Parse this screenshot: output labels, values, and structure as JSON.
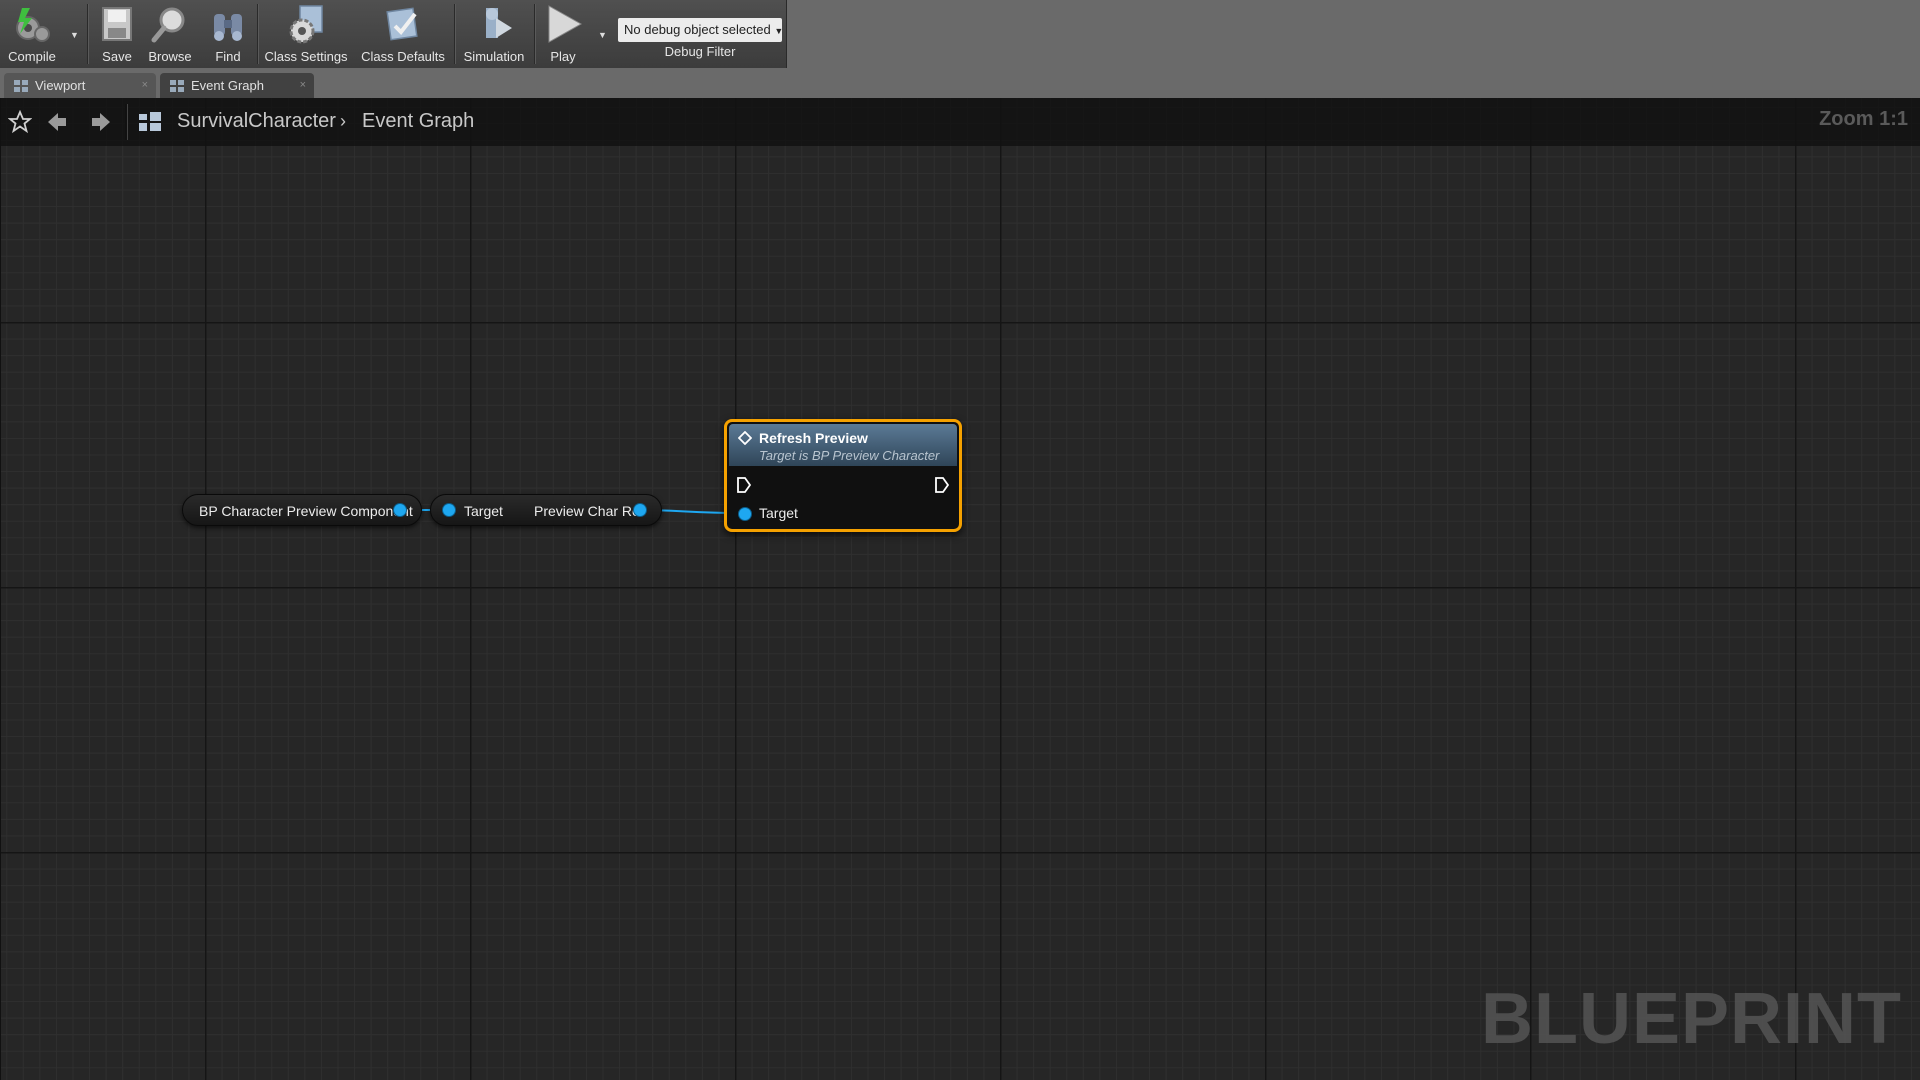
{
  "toolbar": {
    "compile": "Compile",
    "save": "Save",
    "browse": "Browse",
    "find": "Find",
    "class_settings": "Class Settings",
    "class_defaults": "Class Defaults",
    "simulation": "Simulation",
    "play": "Play",
    "debug_object": "No debug object selected",
    "debug_filter": "Debug Filter"
  },
  "tabs": [
    {
      "label": "Viewport",
      "active": false
    },
    {
      "label": "Event Graph",
      "active": true
    }
  ],
  "breadcrumb": {
    "root": "SurvivalCharacter",
    "current": "Event Graph"
  },
  "zoom": "Zoom 1:1",
  "watermark": "BLUEPRINT",
  "graph": {
    "component_node": "BP Character Preview Component",
    "getter_target": "Target",
    "getter_output": "Preview Char Ref",
    "function_node": {
      "title": "Refresh Preview",
      "subtitle": "Target is BP Preview Character",
      "target_pin": "Target"
    }
  },
  "colors": {
    "pin_blue": "#1ea7f0",
    "selection_orange": "#f5a100",
    "graph_bg": "#262626"
  }
}
